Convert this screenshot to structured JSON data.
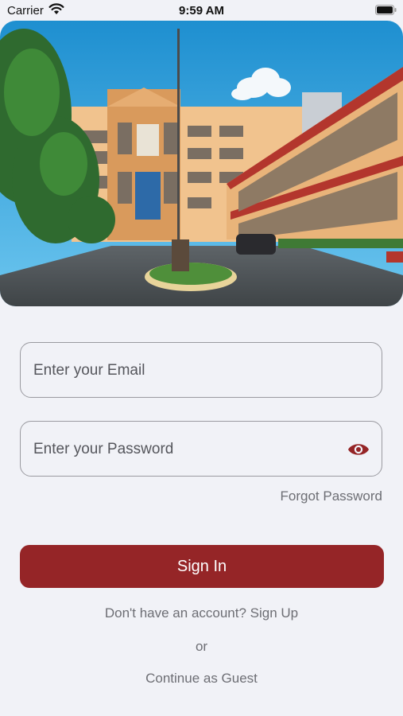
{
  "status_bar": {
    "carrier": "Carrier",
    "time": "9:59 AM",
    "icons": [
      "wifi-icon",
      "battery-icon"
    ]
  },
  "hero": {
    "image": "school-building-photo"
  },
  "login": {
    "email_placeholder": "Enter your Email",
    "password_placeholder": "Enter your Password",
    "password_toggle_icon": "eye-icon",
    "forgot_password": "Forgot Password",
    "sign_in": "Sign In",
    "signup_prompt": "Don't have an account? Sign Up",
    "or": "or",
    "guest": "Continue as Guest"
  },
  "colors": {
    "accent": "#952527",
    "background": "#f1f2f7",
    "muted_text": "#6d6e74"
  }
}
